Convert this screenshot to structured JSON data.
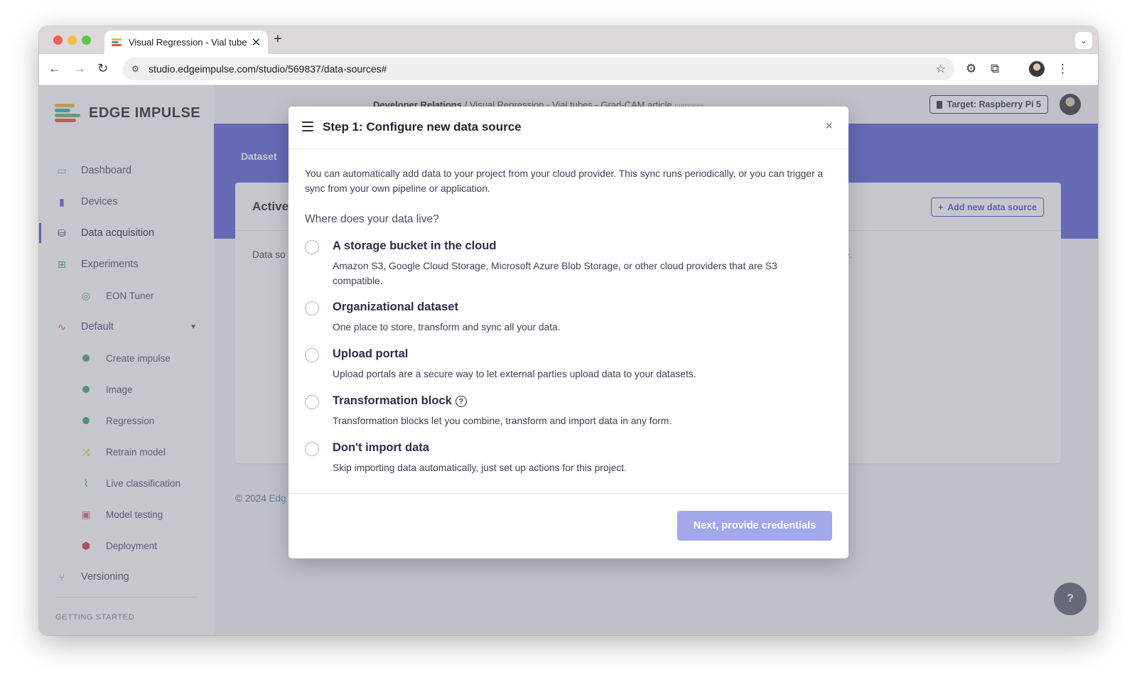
{
  "browser": {
    "tab_title": "Visual Regression - Vial tubes",
    "tab_close": "✕",
    "new_tab": "+",
    "url": "studio.edgeimpulse.com/studio/569837/data-sources#"
  },
  "logo": {
    "text": "EDGE IMPULSE"
  },
  "sidebar": {
    "items": [
      {
        "label": "Dashboard",
        "icon": "monitor-icon"
      },
      {
        "label": "Devices",
        "icon": "chip-icon"
      },
      {
        "label": "Data acquisition",
        "icon": "database-icon"
      },
      {
        "label": "Experiments",
        "icon": "table-icon"
      },
      {
        "label": "EON Tuner",
        "icon": "compass-icon"
      },
      {
        "label": "Default",
        "icon": "pulse-icon"
      },
      {
        "label": "Create impulse",
        "icon": "status-dot-icon"
      },
      {
        "label": "Image",
        "icon": "status-dot-icon"
      },
      {
        "label": "Regression",
        "icon": "status-dot-icon"
      },
      {
        "label": "Retrain model",
        "icon": "shuffle-icon"
      },
      {
        "label": "Live classification",
        "icon": "signal-icon"
      },
      {
        "label": "Model testing",
        "icon": "clipboard-icon"
      },
      {
        "label": "Deployment",
        "icon": "package-icon"
      },
      {
        "label": "Versioning",
        "icon": "branch-icon"
      }
    ],
    "section_label": "GETTING STARTED"
  },
  "topbar": {
    "breadcrumb_org": "Developer Relations",
    "breadcrumb_sep": "/",
    "breadcrumb_project": "Visual Regression - Vial tubes - Grad-CAM article",
    "breadcrumb_owner": "purposes",
    "target": "Target: Raspberry Pi 5"
  },
  "hero": {
    "tab_label": "Dataset"
  },
  "card": {
    "title": "Active",
    "add_button": "Add new data source",
    "body_text": "Data so",
    "body_link": "ore."
  },
  "footer": {
    "copyright": "© 2024",
    "brand": "Edg"
  },
  "help": {
    "label": "?"
  },
  "modal": {
    "title": "Step 1: Configure new data source",
    "close": "×",
    "intro": "You can automatically add data to your project from your cloud provider. This sync runs periodically, or you can trigger a sync from your own pipeline or application.",
    "question": "Where does your data live?",
    "options": [
      {
        "title": "A storage bucket in the cloud",
        "description": "Amazon S3, Google Cloud Storage, Microsoft Azure Blob Storage, or other cloud providers that are S3 compatible."
      },
      {
        "title": "Organizational dataset",
        "description": "One place to store, transform and sync all your data."
      },
      {
        "title": "Upload portal",
        "description": "Upload portals are a secure way to let external parties upload data to your datasets."
      },
      {
        "title": "Transformation block",
        "description": "Transformation blocks let you combine, transform and import data in any form."
      },
      {
        "title": "Don't import data",
        "description": "Skip importing data automatically, just set up actions for this project."
      }
    ],
    "next_button": "Next, provide credentials"
  },
  "colors": {
    "accent": "#5b5fd6",
    "button_disabled": "#a3a7ec",
    "status_green": "#37a567"
  }
}
